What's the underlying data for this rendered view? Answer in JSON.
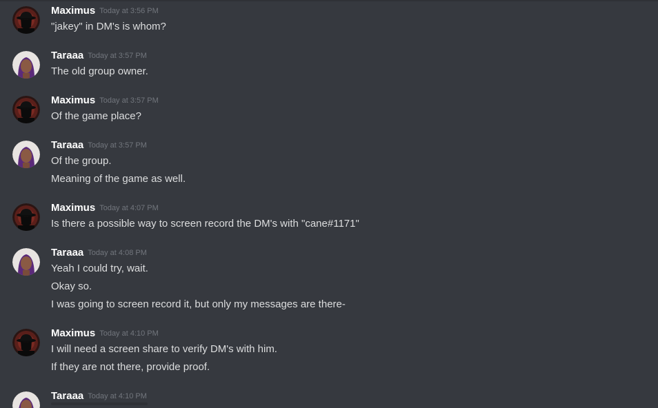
{
  "messages": [
    {
      "author": "Maximus",
      "avatar": "dark-hat-avatar",
      "timestamp": "Today at 3:56 PM",
      "lines": [
        "\"jakey\" in DM's is whom?"
      ]
    },
    {
      "author": "Taraaa",
      "avatar": "purple-hair-avatar",
      "timestamp": "Today at 3:57 PM",
      "lines": [
        "The old group owner."
      ]
    },
    {
      "author": "Maximus",
      "avatar": "dark-hat-avatar",
      "timestamp": "Today at 3:57 PM",
      "lines": [
        "Of the game place?"
      ]
    },
    {
      "author": "Taraaa",
      "avatar": "purple-hair-avatar",
      "timestamp": "Today at 3:57 PM",
      "lines": [
        "Of the group.",
        "Meaning of the game as well."
      ]
    },
    {
      "author": "Maximus",
      "avatar": "dark-hat-avatar",
      "timestamp": "Today at 4:07 PM",
      "lines": [
        "Is there a possible way to screen record the DM's with \"cane#1171\""
      ]
    },
    {
      "author": "Taraaa",
      "avatar": "purple-hair-avatar",
      "timestamp": "Today at 4:08 PM",
      "lines": [
        "Yeah I could try, wait.",
        "Okay so.",
        "I was going to screen record it, but only my messages are there-"
      ]
    },
    {
      "author": "Maximus",
      "avatar": "dark-hat-avatar",
      "timestamp": "Today at 4:10 PM",
      "lines": [
        "I will need a screen share to verify DM's with him.",
        "If they are not there, provide proof."
      ]
    },
    {
      "author": "Taraaa",
      "avatar": "purple-hair-avatar",
      "timestamp": "Today at 4:10 PM",
      "lines": []
    }
  ],
  "colors": {
    "background": "#36393f",
    "author": "#ffffff",
    "text": "#dcddde",
    "timestamp": "#72767d"
  }
}
